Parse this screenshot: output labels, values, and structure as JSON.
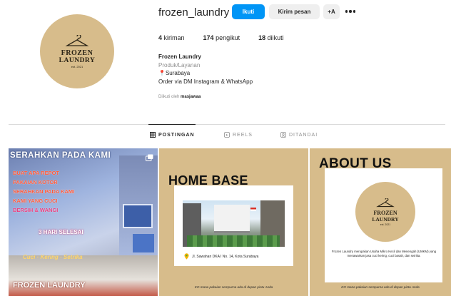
{
  "profile": {
    "username": "frozen_laundry",
    "follow_label": "Ikuti",
    "message_label": "Kirim pesan",
    "suggest_label": "+A",
    "avatar_logo": {
      "line1": "FROZEN",
      "line2": "LAUNDRY",
      "est": "est. 2021"
    },
    "stats": [
      {
        "count": "4",
        "label": "kiriman"
      },
      {
        "count": "174",
        "label": "pengikut"
      },
      {
        "count": "18",
        "label": "diikuti"
      }
    ],
    "bio": {
      "name": "Frozen Laundry",
      "category": "Produk/Layanan",
      "location": "Surabaya",
      "line": "Order via DM Instagram & WhatsApp"
    },
    "followed_by_prefix": "Diikuti oleh",
    "followed_by_user": "masjawaa"
  },
  "tabs": [
    {
      "label": "POSTINGAN",
      "active": true,
      "icon": "grid-icon"
    },
    {
      "label": "REELS",
      "active": false,
      "icon": "reels-icon"
    },
    {
      "label": "DITANDAI",
      "active": false,
      "icon": "tagged-icon"
    }
  ],
  "posts": {
    "post1": {
      "headline": "SERAHKAN PADA KAMI",
      "lines": [
        "BUAT APA REPOT",
        "PAKAIAN KOTOR",
        "SERAHKAN PADA KAMI",
        "KAMI YANG CUCI",
        "BERSIH & WANGI"
      ],
      "hours": "3 HARI SELESAI",
      "footer": "Cuci · Kering · Setrika",
      "store_sign": "FROZEN LAUNDRY"
    },
    "post2": {
      "title": "HOME BASE",
      "address": "Jl. Sawahan DKA I No. 14, Kota Surabaya",
      "footer": "KO mana pakaian sempurna ada di depan pintu Anda"
    },
    "post3": {
      "title": "ABOUT US",
      "logo": {
        "line1": "FROZEN",
        "line2": "LAUNDRY",
        "est": "est. 2021"
      },
      "text": "Frozen Laundry merupakan Usaha Mikro Kecil dan Menengah (UMKM) yang menawarkan jasa cuci kering, cuci basah, dan setrika.",
      "footer": "KO mana pakaian sempurna ada di depan pintu Anda"
    }
  },
  "colors": {
    "brand_tan": "#d7bc8b",
    "follow_blue": "#0095f6",
    "text": "#262626",
    "muted": "#8e8e8e"
  }
}
